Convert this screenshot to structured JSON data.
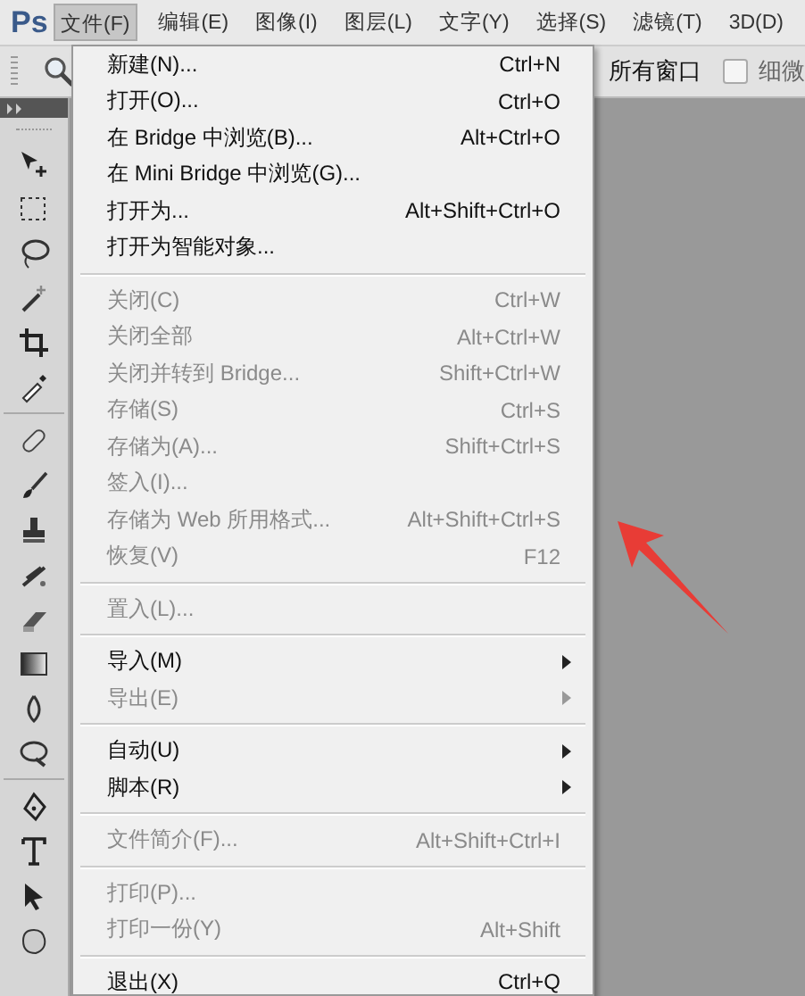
{
  "app_logo": "Ps",
  "menubar": [
    {
      "label": "文件(F)",
      "selected": true
    },
    {
      "label": "编辑(E)",
      "selected": false
    },
    {
      "label": "图像(I)",
      "selected": false
    },
    {
      "label": "图层(L)",
      "selected": false
    },
    {
      "label": "文字(Y)",
      "selected": false
    },
    {
      "label": "选择(S)",
      "selected": false
    },
    {
      "label": "滤镜(T)",
      "selected": false
    },
    {
      "label": "3D(D)",
      "selected": false
    }
  ],
  "options_bar": {
    "partial_label": "所有窗口",
    "checkbox": {
      "label": "细微",
      "checked": false
    }
  },
  "file_menu": [
    [
      {
        "label": "新建(N)...",
        "shortcut": "Ctrl+N",
        "disabled": false
      },
      {
        "label": "打开(O)...",
        "shortcut": "Ctrl+O",
        "disabled": false
      },
      {
        "label": "在 Bridge 中浏览(B)...",
        "shortcut": "Alt+Ctrl+O",
        "disabled": false
      },
      {
        "label": "在 Mini Bridge 中浏览(G)...",
        "disabled": false
      },
      {
        "label": "打开为...",
        "shortcut": "Alt+Shift+Ctrl+O",
        "disabled": false
      },
      {
        "label": "打开为智能对象...",
        "disabled": false
      }
    ],
    [
      {
        "label": "关闭(C)",
        "shortcut": "Ctrl+W",
        "disabled": true
      },
      {
        "label": "关闭全部",
        "shortcut": "Alt+Ctrl+W",
        "disabled": true
      },
      {
        "label": "关闭并转到 Bridge...",
        "shortcut": "Shift+Ctrl+W",
        "disabled": true
      },
      {
        "label": "存储(S)",
        "shortcut": "Ctrl+S",
        "disabled": true
      },
      {
        "label": "存储为(A)...",
        "shortcut": "Shift+Ctrl+S",
        "disabled": true
      },
      {
        "label": "签入(I)...",
        "disabled": true
      },
      {
        "label": "存储为 Web 所用格式...",
        "shortcut": "Alt+Shift+Ctrl+S",
        "disabled": true
      },
      {
        "label": "恢复(V)",
        "shortcut": "F12",
        "disabled": true
      }
    ],
    [
      {
        "label": "置入(L)...",
        "disabled": true
      }
    ],
    [
      {
        "label": "导入(M)",
        "disabled": false,
        "submenu": true
      },
      {
        "label": "导出(E)",
        "disabled": true,
        "submenu": true
      }
    ],
    [
      {
        "label": "自动(U)",
        "disabled": false,
        "submenu": true
      },
      {
        "label": "脚本(R)",
        "disabled": false,
        "submenu": true
      }
    ],
    [
      {
        "label": "文件简介(F)...",
        "shortcut": "Alt+Shift+Ctrl+I",
        "disabled": true
      }
    ],
    [
      {
        "label": "打印(P)...",
        "disabled": true
      },
      {
        "label": "打印一份(Y)",
        "shortcut": "Alt+Shift",
        "disabled": true
      }
    ],
    [
      {
        "label": "退出(X)",
        "shortcut": "Ctrl+Q",
        "disabled": false
      }
    ]
  ]
}
